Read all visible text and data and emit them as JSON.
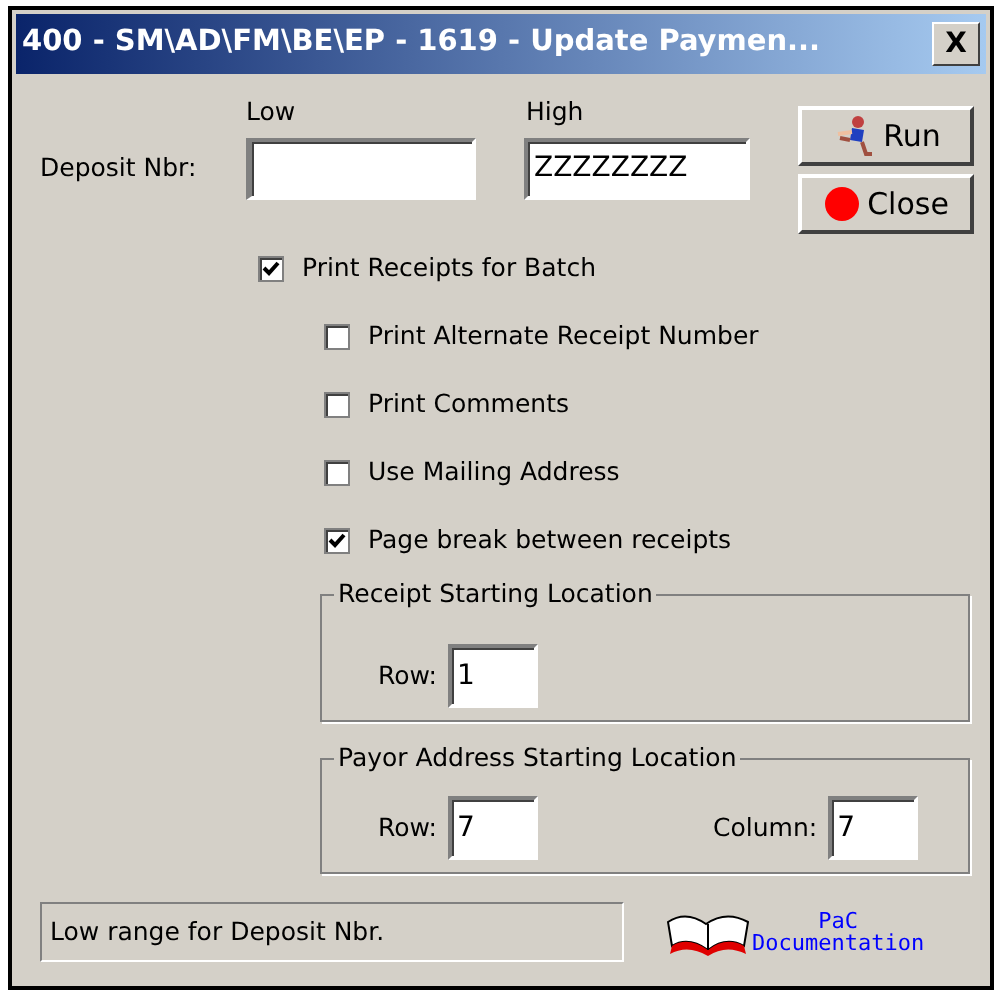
{
  "window": {
    "title": "400 - SM\\AD\\FM\\BE\\EP - 1619 - Update Paymen...",
    "close_glyph": "X"
  },
  "range": {
    "label": "Deposit Nbr:",
    "low_header": "Low",
    "high_header": "High",
    "high_value": "ZZZZZZZZ",
    "low_focused": true
  },
  "buttons": [
    {
      "kind": "run",
      "label": "Run"
    },
    {
      "kind": "close",
      "label": "Close"
    }
  ],
  "options": [
    {
      "label": "Print Receipts for Batch",
      "checked": true,
      "children": [
        {
          "label": "Print Alternate Receipt Number",
          "checked": false
        },
        {
          "label": "Print Comments",
          "checked": false
        },
        {
          "label": "Use Mailing Address",
          "checked": false
        },
        {
          "label": "Page break between receipts",
          "checked": true
        }
      ]
    }
  ],
  "groups": [
    {
      "title": "Receipt Starting Location",
      "fields": [
        {
          "label": "Row:",
          "value": "1"
        }
      ]
    },
    {
      "title": "Payor Address Starting Location",
      "fields": [
        {
          "label": "Row:",
          "value": "7"
        },
        {
          "label": "Column:",
          "value": "7"
        }
      ]
    }
  ],
  "status_bar": {
    "text": "Low range for Deposit Nbr."
  },
  "doc_link": {
    "line_1": "PaC",
    "line_2": "Documentation"
  }
}
